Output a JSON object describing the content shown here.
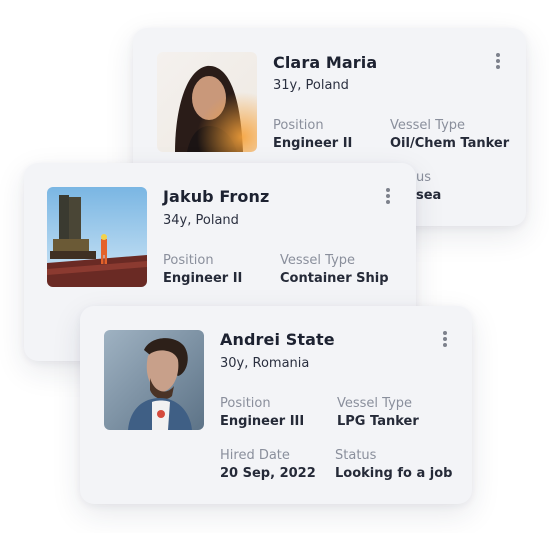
{
  "cards": [
    {
      "name": "Clara Maria",
      "age_country": "31y, Poland",
      "position_label": "Position",
      "position": "Engineer II",
      "vessel_label": "Vessel Type",
      "vessel": "Oil/Chem Tanker"
    },
    {
      "name": "Jakub Fronz",
      "age_country": "34y, Poland",
      "position_label": "Position",
      "position": "Engineer II",
      "vessel_label": "Vessel Type",
      "vessel": "Container Ship"
    },
    {
      "name": "Andrei  State",
      "age_country": "30y, Romania",
      "position_label": "Position",
      "position": "Engineer III",
      "vessel_label": "Vessel Type",
      "vessel": "LPG Tanker",
      "hired_label": "Hired Date",
      "hired": "20 Sep, 2022",
      "status_label": "Status",
      "status": "Looking fo a job"
    }
  ],
  "overlap_fragments": {
    "status_label_tail": "us",
    "status_value_tail": "sea"
  },
  "colors": {
    "card_bg": "#f3f4f7",
    "name_text": "#1d2231",
    "label_text": "#8a8f9c",
    "value_text": "#252a38",
    "kebab": "#7d818c"
  },
  "icons": [
    "more-vertical-icon"
  ]
}
